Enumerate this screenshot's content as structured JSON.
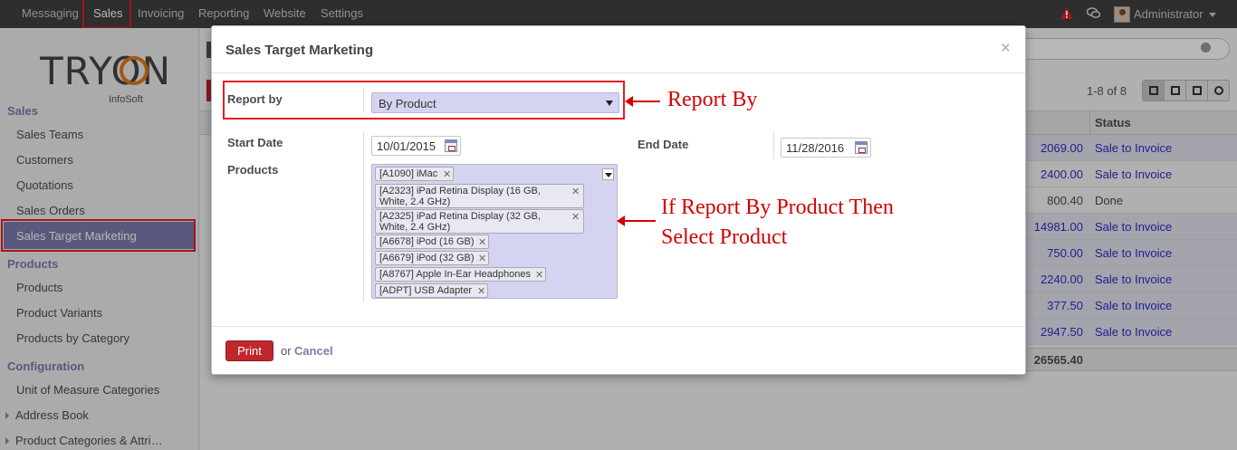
{
  "topnav": {
    "items": [
      "Messaging",
      "Sales",
      "Invoicing",
      "Reporting",
      "Website",
      "Settings"
    ],
    "user": "Administrator"
  },
  "logo": {
    "main": "TRYON",
    "sub": "InfoSoft"
  },
  "sidebar": {
    "sales_header": "Sales",
    "sales_items": [
      "Sales Teams",
      "Customers",
      "Quotations",
      "Sales Orders",
      "Sales Target Marketing"
    ],
    "products_header": "Products",
    "products_items": [
      "Products",
      "Product Variants",
      "Products by Category"
    ],
    "config_header": "Configuration",
    "config_items": [
      "Unit of Measure Categories",
      "Address Book",
      "Product Categories & Attri…"
    ]
  },
  "background": {
    "pager": "1-8 of 8",
    "status_header": "Status",
    "rows": [
      {
        "amount": "2069.00",
        "status": "Sale to Invoice"
      },
      {
        "amount": "2400.00",
        "status": "Sale to Invoice"
      },
      {
        "amount": "800.40",
        "status": "Done"
      },
      {
        "amount": "14981.00",
        "status": "Sale to Invoice"
      },
      {
        "amount": "750.00",
        "status": "Sale to Invoice"
      },
      {
        "amount": "2240.00",
        "status": "Sale to Invoice"
      },
      {
        "amount": "377.50",
        "status": "Sale to Invoice"
      },
      {
        "amount": "2947.50",
        "status": "Sale to Invoice"
      }
    ],
    "total": "26565.40"
  },
  "modal": {
    "title": "Sales Target Marketing",
    "close": "×",
    "report_by_label": "Report by",
    "report_by_value": "By Product",
    "start_date_label": "Start Date",
    "start_date": "10/01/2015",
    "end_date_label": "End Date",
    "end_date": "11/28/2016",
    "products_label": "Products",
    "products": [
      "[A1090] iMac",
      "[A2323] iPad Retina Display (16 GB, White, 2.4 GHz)",
      "[A2325] iPad Retina Display (32 GB, White, 2.4 GHz)",
      "[A6678] iPod (16 GB)",
      "[A6679] iPod (32 GB)",
      "[A8767] Apple In-Ear Headphones",
      "[ADPT] USB Adapter"
    ],
    "print_label": "Print",
    "or_label": "or",
    "cancel_label": "Cancel"
  },
  "annotations": {
    "report_by": "Report By",
    "product_line1": "If Report By Product Then",
    "product_line2": "Select Product"
  },
  "colors": {
    "accent": "#7c7bad",
    "annotation": "#d40000",
    "print_button": "#c0272d",
    "link_blue": "#2c2cc8"
  }
}
